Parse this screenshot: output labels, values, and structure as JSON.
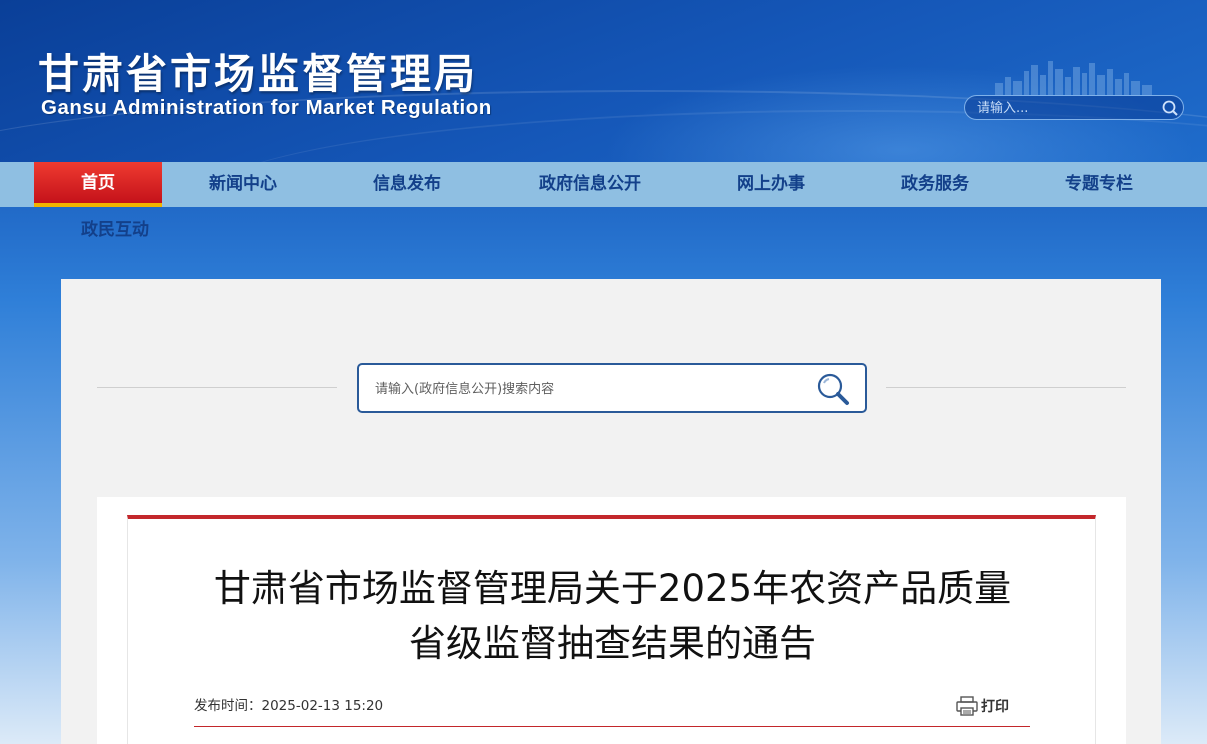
{
  "header": {
    "title": "甘肃省市场监督管理局",
    "subtitle": "Gansu Administration for Market Regulation",
    "search_placeholder": "请输入..."
  },
  "nav": {
    "items": [
      {
        "label": "首页",
        "active": true
      },
      {
        "label": "新闻中心"
      },
      {
        "label": "信息发布"
      },
      {
        "label": "政府信息公开"
      },
      {
        "label": "网上办事"
      },
      {
        "label": "政务服务"
      },
      {
        "label": "专题专栏"
      },
      {
        "label": "政民互动"
      }
    ]
  },
  "main": {
    "search_placeholder": "请输入(政府信息公开)搜索内容",
    "article": {
      "title_line1": "甘肃省市场监督管理局关于2025年农资产品质量",
      "title_line2": "省级监督抽查结果的通告",
      "publish_time": "发布时间：2025-02-13 15:20",
      "print_label": "打印"
    }
  },
  "colors": {
    "nav_bg": "#8fbfe2",
    "nav_active": "#d8201f",
    "accent_red": "#c3272b",
    "nav_text": "#13408a"
  }
}
